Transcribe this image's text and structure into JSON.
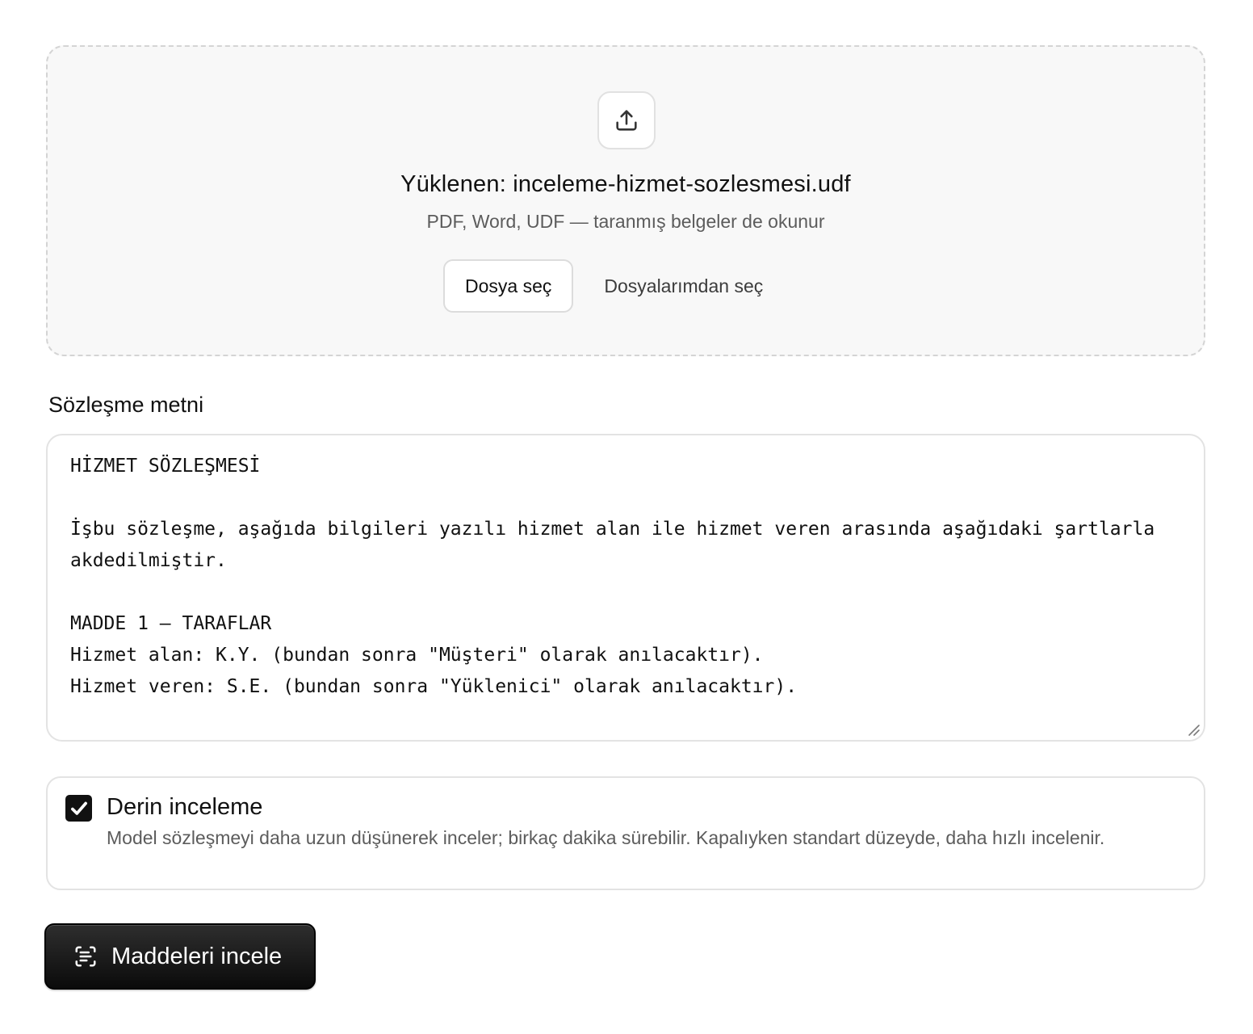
{
  "upload": {
    "icon": "upload-icon",
    "title": "Yüklenen: inceleme-hizmet-sozlesmesi.udf",
    "subtitle": "PDF, Word, UDF — taranmış belgeler de okunur",
    "choose_file_label": "Dosya seç",
    "choose_from_files_label": "Dosyalarımdan seç"
  },
  "contract": {
    "label": "Sözleşme metni",
    "text": "HİZMET SÖZLEŞMESİ\n\nİşbu sözleşme, aşağıda bilgileri yazılı hizmet alan ile hizmet veren arasında aşağıdaki şartlarla akdedilmiştir.\n\nMADDE 1 — TARAFLAR\nHizmet alan: K.Y. (bundan sonra \"Müşteri\" olarak anılacaktır).\nHizmet veren: S.E. (bundan sonra \"Yüklenici\" olarak anılacaktır)."
  },
  "deep_review": {
    "checked": true,
    "title": "Derin inceleme",
    "description": "Model sözleşmeyi daha uzun düşünerek inceler; birkaç dakika sürebilir. Kapalıyken standart düzeyde, daha hızlı incelenir."
  },
  "action": {
    "icon": "scan-text-icon",
    "label": "Maddeleri incele"
  },
  "colors": {
    "primary": "#111111",
    "muted_text": "#5c5c5c",
    "border": "#e3e3e3",
    "dropzone_bg": "#f8f8f8"
  }
}
